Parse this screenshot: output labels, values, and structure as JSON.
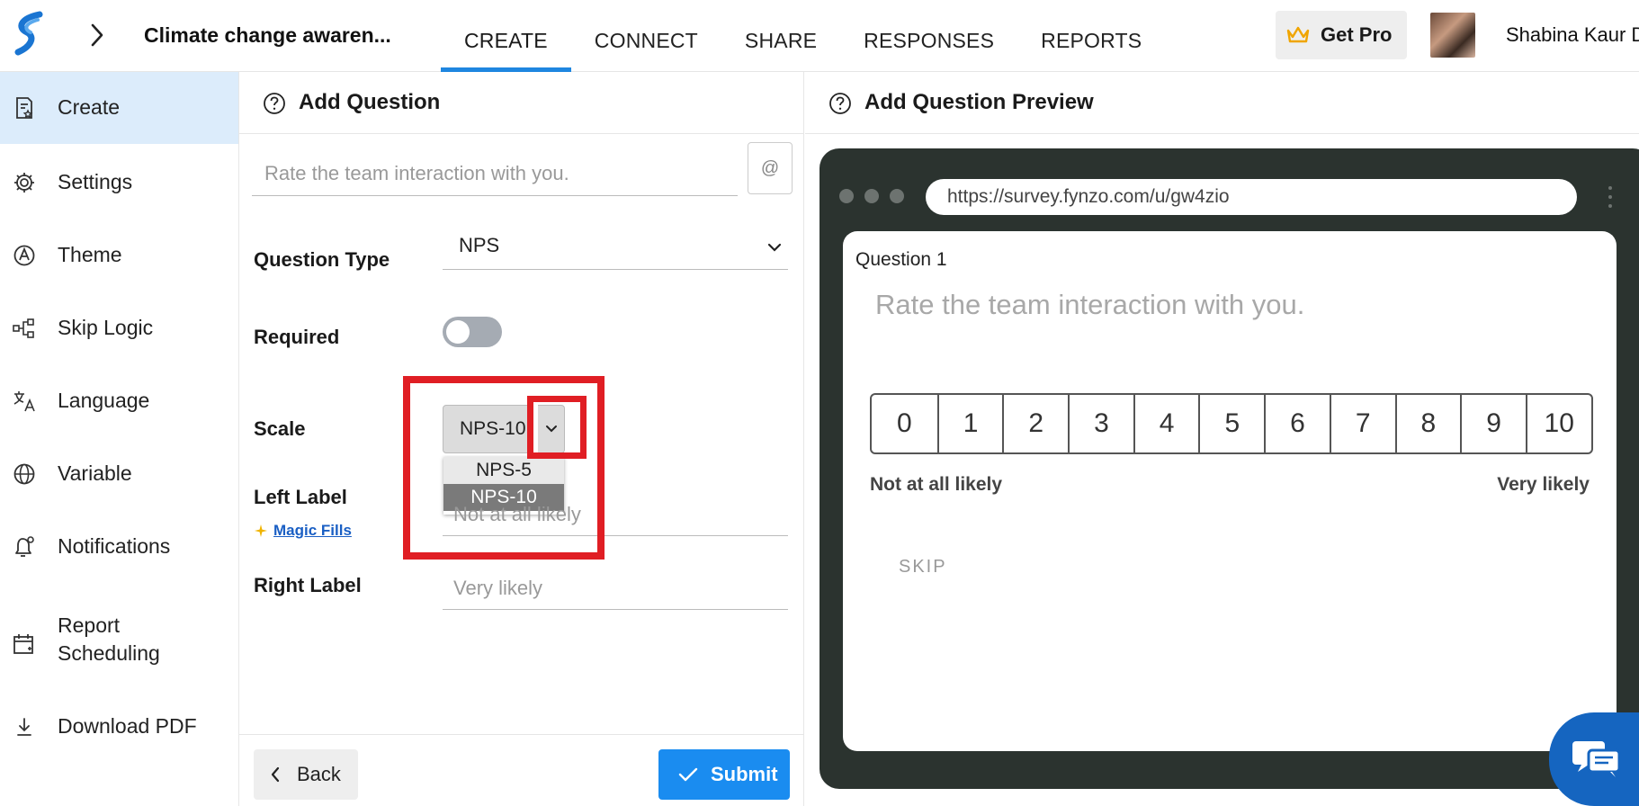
{
  "header": {
    "survey_title": "Climate change awaren...",
    "tabs": [
      {
        "label": "CREATE",
        "active": true
      },
      {
        "label": "CONNECT",
        "active": false
      },
      {
        "label": "SHARE",
        "active": false
      },
      {
        "label": "RESPONSES",
        "active": false
      },
      {
        "label": "REPORTS",
        "active": false
      }
    ],
    "get_pro_label": "Get Pro",
    "user_name": "Shabina Kaur D"
  },
  "sidebar": {
    "items": [
      {
        "label": "Create",
        "icon": "document-star-icon",
        "active": true
      },
      {
        "label": "Settings",
        "icon": "gear-icon"
      },
      {
        "label": "Theme",
        "icon": "palette-icon"
      },
      {
        "label": "Skip Logic",
        "icon": "flow-icon"
      },
      {
        "label": "Language",
        "icon": "translate-icon"
      },
      {
        "label": "Variable",
        "icon": "globe-icon"
      },
      {
        "label": "Notifications",
        "icon": "bell-icon"
      },
      {
        "label": "Report Scheduling",
        "icon": "calendar-icon"
      },
      {
        "label": "Download PDF",
        "icon": "download-icon"
      }
    ]
  },
  "editor": {
    "title": "Add Question",
    "question_placeholder": "Rate the team interaction with you.",
    "at_label": "@",
    "question_type_label": "Question Type",
    "question_type_value": "NPS",
    "required_label": "Required",
    "required_on": false,
    "scale_label": "Scale",
    "scale_value": "NPS-10",
    "scale_options": [
      "NPS-5",
      "NPS-10"
    ],
    "left_label_label": "Left Label",
    "left_label_placeholder": "Not at all likely",
    "magic_fills": "Magic Fills",
    "right_label_label": "Right Label",
    "right_label_placeholder": "Very likely",
    "back_label": "Back",
    "submit_label": "Submit"
  },
  "preview": {
    "title": "Add Question Preview",
    "url": "https://survey.fynzo.com/u/gw4zio",
    "question_number": "Question 1",
    "question_text": "Rate the team interaction with you.",
    "scale": [
      "0",
      "1",
      "2",
      "3",
      "4",
      "5",
      "6",
      "7",
      "8",
      "9",
      "10"
    ],
    "left_label": "Not at all likely",
    "right_label": "Very likely",
    "skip_label": "SKIP"
  },
  "colors": {
    "accent": "#1f86e0",
    "submit": "#1a8cf0",
    "highlight": "#e01e24",
    "sidebar_active": "#dcecfb",
    "device_frame": "#2b332f"
  }
}
